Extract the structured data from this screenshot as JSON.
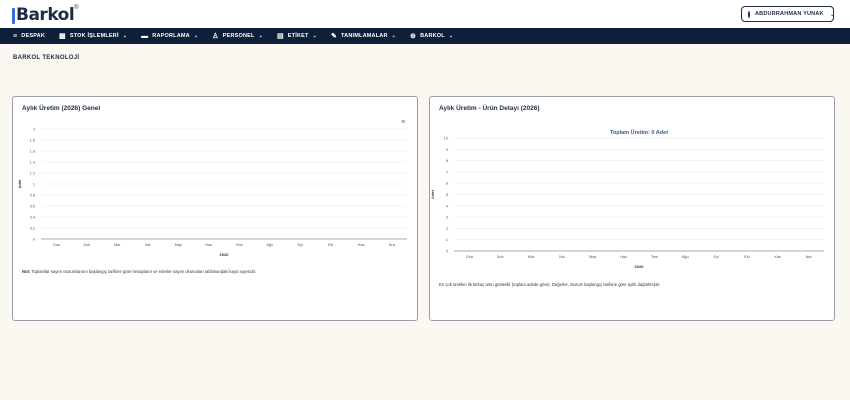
{
  "brand": {
    "name": "Barkol",
    "reg": "®"
  },
  "user": {
    "name": "ABDURRAHMAN YUNAK"
  },
  "nav": [
    {
      "label": "DESPAK",
      "icon": "≡",
      "dropdown": false,
      "name": "nav-despak",
      "icon_name": "menu-icon"
    },
    {
      "label": "STOK İŞLEMLERİ",
      "icon": "▦",
      "dropdown": true,
      "name": "nav-stok-islemleri",
      "icon_name": "barcode-icon"
    },
    {
      "label": "RAPORLAMA",
      "icon": "▬",
      "dropdown": true,
      "name": "nav-raporlama",
      "icon_name": "folder-icon"
    },
    {
      "label": "PERSONEL",
      "icon": "♙",
      "dropdown": true,
      "name": "nav-personel",
      "icon_name": "person-icon"
    },
    {
      "label": "ETİKET",
      "icon": "▤",
      "dropdown": true,
      "name": "nav-etiket",
      "icon_name": "label-icon"
    },
    {
      "label": "TANIMLAMALAR",
      "icon": "✎",
      "dropdown": true,
      "name": "nav-tanimlamalar",
      "icon_name": "edit-icon"
    },
    {
      "label": "BARKOL",
      "icon": "⊕",
      "dropdown": true,
      "name": "nav-barkol",
      "icon_name": "globe-icon"
    }
  ],
  "company": "BARKOL TEKNOLOJİ",
  "cards": {
    "left": {
      "title": "Aylık Üretim (2026) Genel",
      "note_bold": "Not:",
      "note": " Toplamlar sayım oturumlarının başlangıç tarihine göre hesaplanır ve ederler sayım okumaları tablosundaki kayıt sayısıdır."
    },
    "right": {
      "title": "Aylık Üretim - Ürün Detayı (2026)",
      "note": "En çok üretilen ilk birkaç ürün gösterilir (toplam adede göre). Değerler, oturum başlangıç tarihine göre aylık dağıtılmıştır."
    }
  },
  "chart_data": [
    {
      "type": "bar",
      "title": "",
      "categories": [
        "Oca",
        "Şub",
        "Mar",
        "Nis",
        "May",
        "Haz",
        "Tem",
        "Ağu",
        "Eyl",
        "Eki",
        "Kas",
        "Ara"
      ],
      "values": [
        0,
        0,
        0,
        0,
        0,
        0,
        0,
        0,
        0,
        0,
        0,
        0
      ],
      "xlabel": "2026",
      "ylabel": "Adet",
      "ylim": [
        0,
        2
      ],
      "yticks": [
        "0",
        "0.2",
        "0.4",
        "0.6",
        "0.8",
        "1",
        "1.2",
        "1.4",
        "1.6",
        "1.8",
        "2"
      ],
      "grid": true
    },
    {
      "type": "bar",
      "title": "Toplam Üretim: 0 Adet",
      "categories": [
        "Oca",
        "Şub",
        "Mar",
        "Nis",
        "May",
        "Haz",
        "Tem",
        "Ağu",
        "Eyl",
        "Eki",
        "Kas",
        "Ara"
      ],
      "values": [
        0,
        0,
        0,
        0,
        0,
        0,
        0,
        0,
        0,
        0,
        0,
        0
      ],
      "xlabel": "2026",
      "ylabel": "Adet",
      "ylim": [
        0,
        10
      ],
      "yticks": [
        "0",
        "1",
        "2",
        "3",
        "4",
        "5",
        "6",
        "7",
        "8",
        "9",
        "10"
      ],
      "grid": true
    }
  ]
}
